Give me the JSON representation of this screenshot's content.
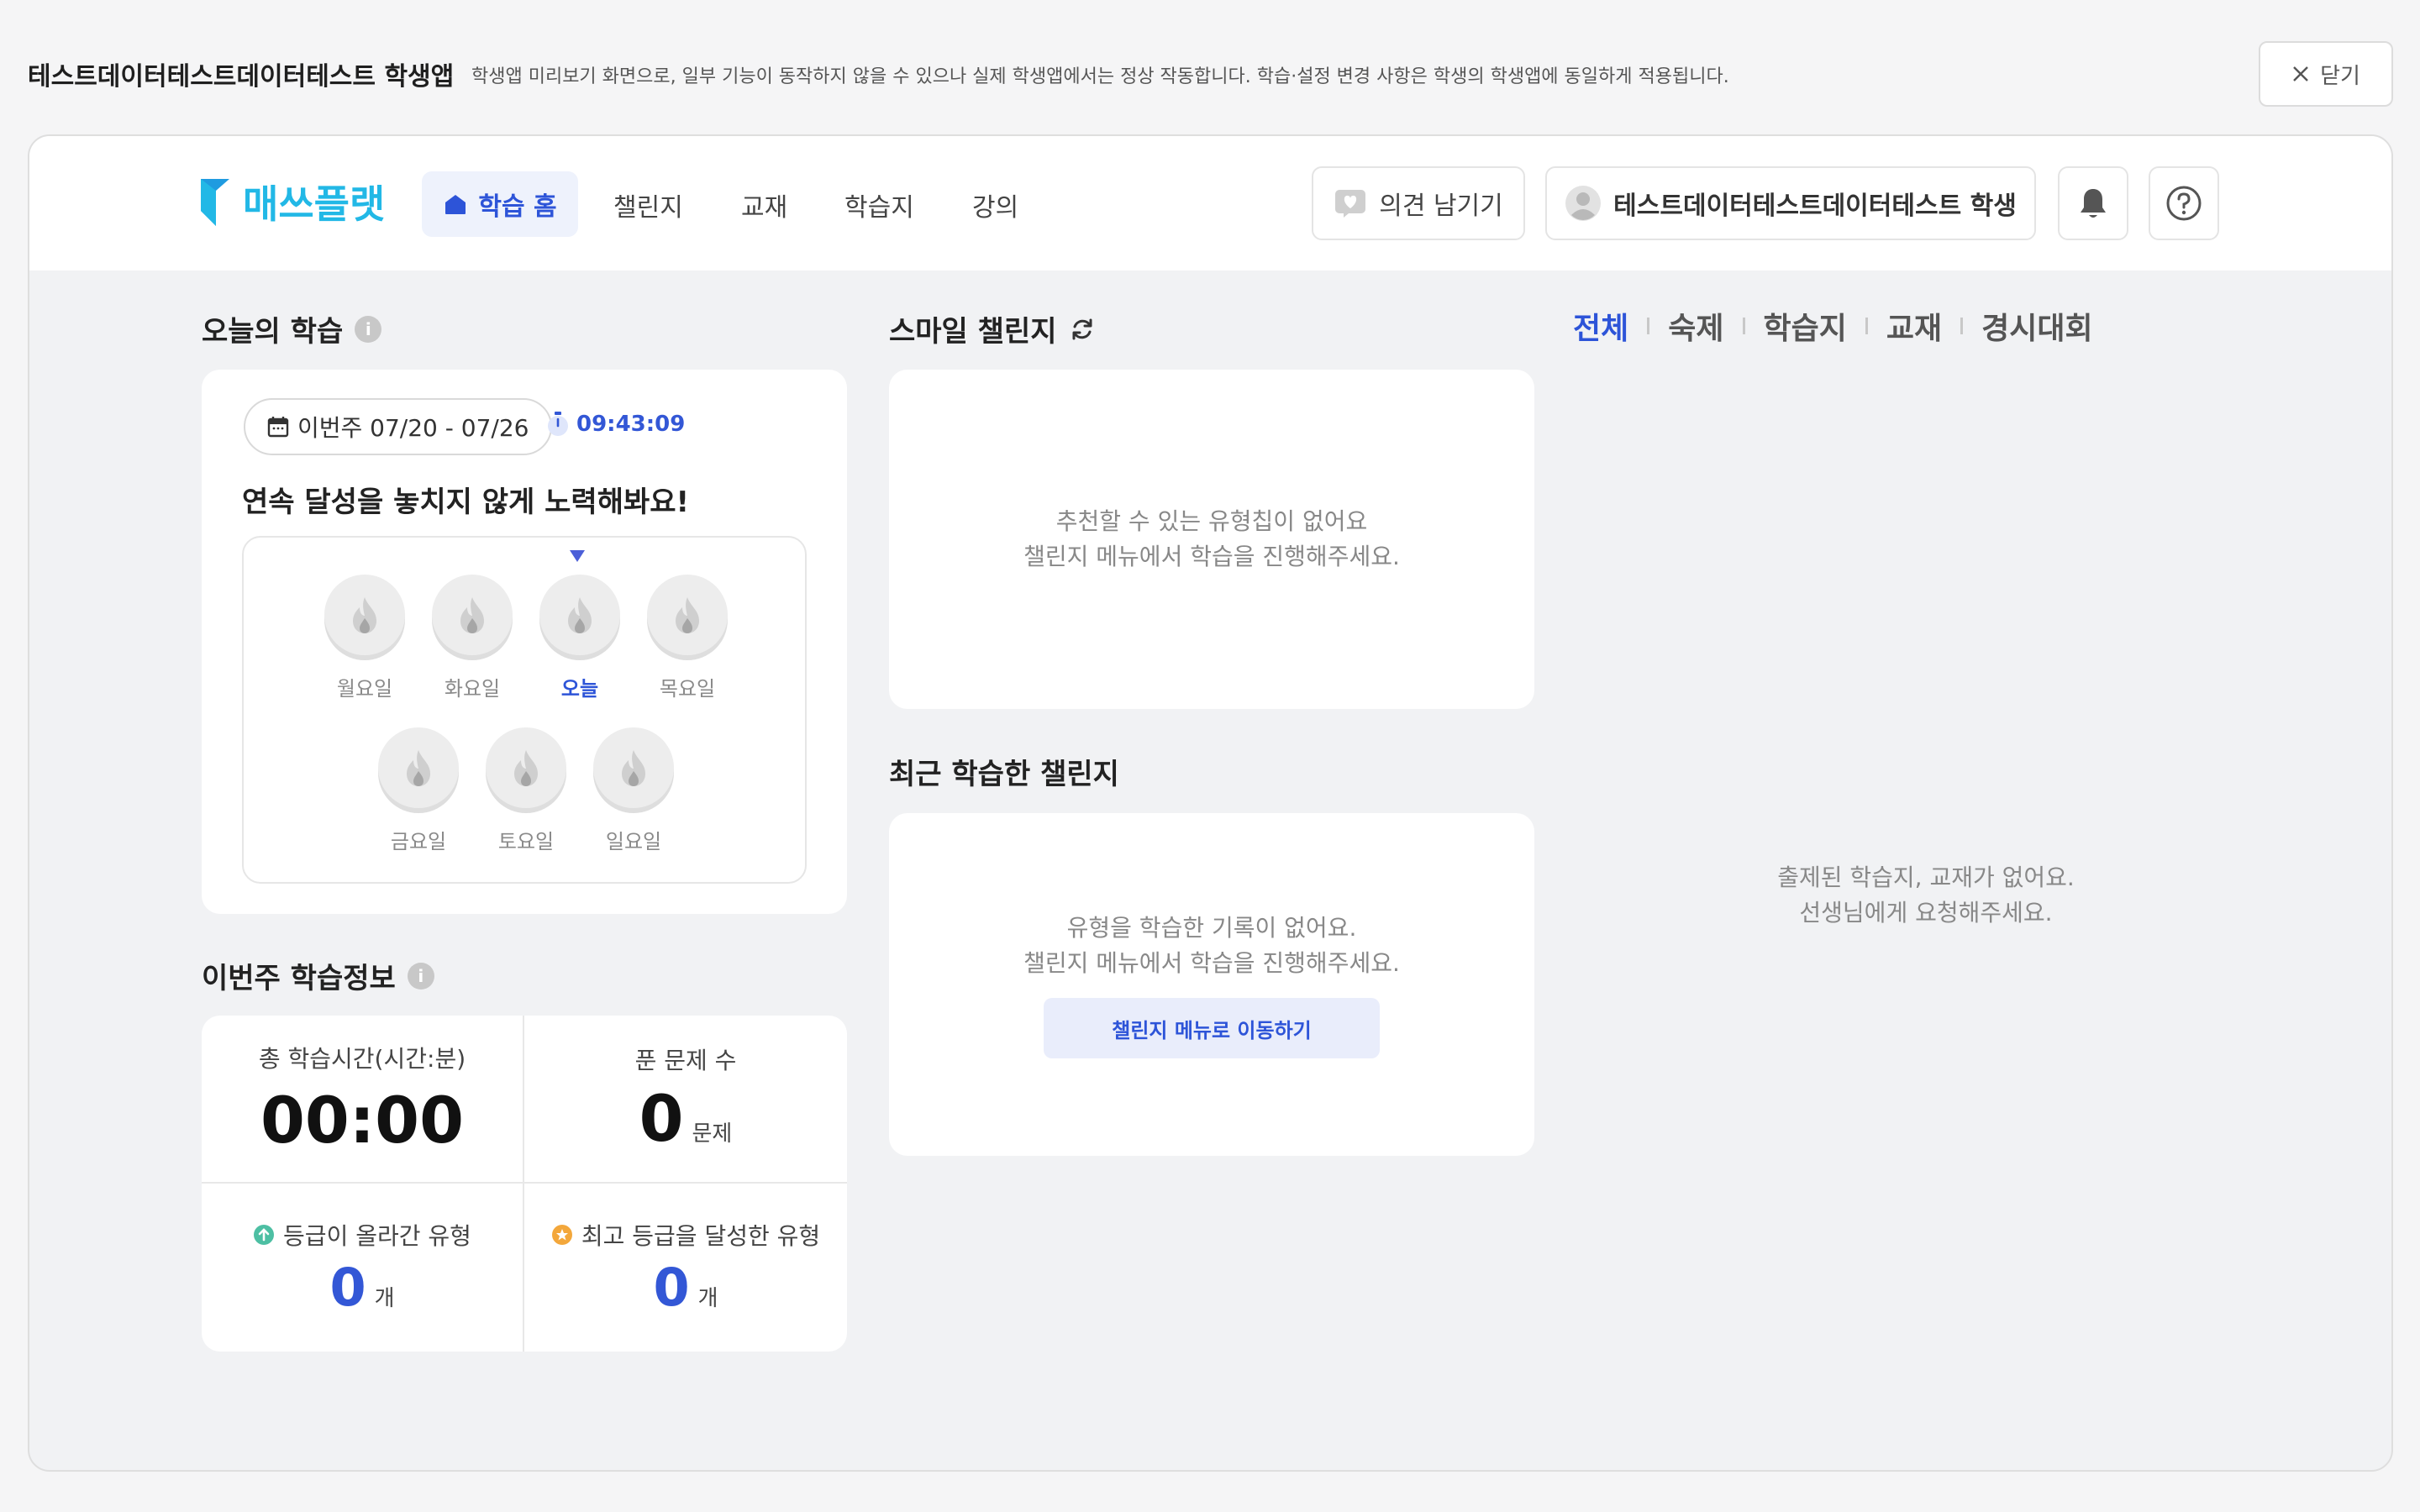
{
  "topbar": {
    "title": "테스트데이터테스트데이터테스트 학생앱",
    "description": "학생앱 미리보기 화면으로, 일부 기능이 동작하지 않을 수 있으나 실제 학생앱에서는 정상 작동합니다. 학습·설정 변경 사항은 학생의 학생앱에 동일하게 적용됩니다.",
    "close_label": "닫기"
  },
  "header": {
    "logo_text": "매쓰플랫",
    "nav": {
      "home": "학습 홈",
      "challenge": "챌린지",
      "textbook": "교재",
      "worksheet": "학습지",
      "lecture": "강의"
    },
    "feedback_label": "의견 남기기",
    "user_name": "테스트데이터테스트데이터테스트 학생"
  },
  "today": {
    "title": "오늘의 학습",
    "date_range": "이번주 07/20 - 07/26",
    "timer": "09:43:09",
    "streak_message": "연속 달성을 놓치지 않게 노력해봐요!",
    "days": [
      "월요일",
      "화요일",
      "오늘",
      "목요일",
      "금요일",
      "토요일",
      "일요일"
    ]
  },
  "weekly": {
    "title": "이번주 학습정보",
    "total_time_label": "총 학습시간(시간:분)",
    "total_time_value": "00:00",
    "solved_label": "푼 문제 수",
    "solved_value": "0",
    "solved_unit": "문제",
    "grade_up_label": "등급이 올라간 유형",
    "grade_up_value": "0",
    "grade_up_unit": "개",
    "top_grade_label": "최고 등급을 달성한 유형",
    "top_grade_value": "0",
    "top_grade_unit": "개"
  },
  "smile": {
    "title": "스마일 챌린지",
    "empty_line1": "추천할 수 있는 유형칩이 없어요",
    "empty_line2": "챌린지 메뉴에서 학습을 진행해주세요."
  },
  "recent": {
    "title": "최근 학습한 챌린지",
    "empty_line1": "유형을 학습한 기록이 없어요.",
    "empty_line2": "챌린지 메뉴에서 학습을 진행해주세요.",
    "button_label": "챌린지 메뉴로 이동하기"
  },
  "filters": {
    "all": "전체",
    "homework": "숙제",
    "worksheet": "학습지",
    "textbook": "교재",
    "contest": "경시대회"
  },
  "assignments": {
    "empty_line1": "출제된 학습지, 교재가 없어요.",
    "empty_line2": "선생님에게 요청해주세요."
  },
  "colors": {
    "accent": "#2d54d8",
    "logo": "#22b8e6",
    "grade_up": "#4dbfa3",
    "top_grade": "#f3a73b"
  }
}
